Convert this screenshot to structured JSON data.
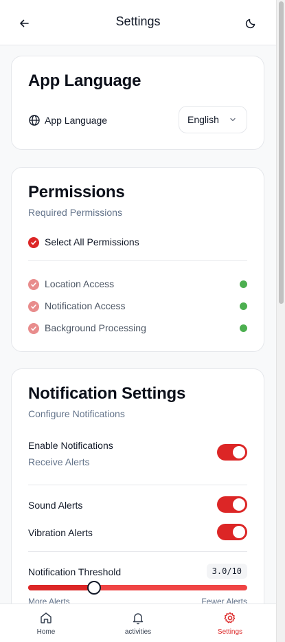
{
  "header": {
    "title": "Settings",
    "back_icon": "arrow-left-icon",
    "theme_icon": "moon-icon"
  },
  "language": {
    "title": "App Language",
    "row_label": "App Language",
    "row_icon": "globe-icon",
    "selected": "English"
  },
  "permissions": {
    "title": "Permissions",
    "subtitle": "Required Permissions",
    "select_all_label": "Select All Permissions",
    "items": [
      {
        "label": "Location Access",
        "granted": true
      },
      {
        "label": "Notification Access",
        "granted": true
      },
      {
        "label": "Background Processing",
        "granted": true
      }
    ]
  },
  "notifications": {
    "title": "Notification Settings",
    "subtitle": "Configure Notifications",
    "enable_label": "Enable Notifications",
    "enable_sub": "Receive Alerts",
    "enable_on": true,
    "sound_label": "Sound Alerts",
    "sound_on": true,
    "vibration_label": "Vibration Alerts",
    "vibration_on": true,
    "threshold_label": "Notification Threshold",
    "threshold_value": "3.0/10",
    "threshold_fraction": 0.3,
    "min_label": "More Alerts",
    "max_label": "Fewer Alerts"
  },
  "tabs": [
    {
      "label": "Home",
      "icon": "home-icon",
      "active": false
    },
    {
      "label": "activities",
      "icon": "bell-icon",
      "active": false
    },
    {
      "label": "Settings",
      "icon": "gear-icon",
      "active": true
    }
  ],
  "colors": {
    "accent": "#dc2626",
    "status_ok": "#4caf50"
  }
}
